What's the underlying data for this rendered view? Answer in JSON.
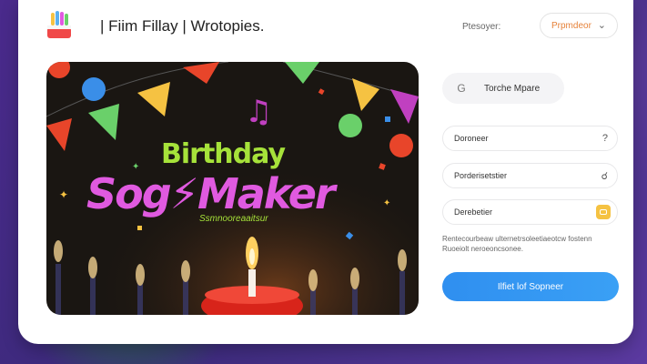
{
  "header": {
    "title": "| Fiim Fillay | Wrotopies.",
    "filter_label": "Ptesoyer:",
    "dropdown_value": "Prpmdeor"
  },
  "hero": {
    "line1": "Birthday",
    "line2": "Sog⚡Maker",
    "subtitle": "Ssmnooreaaitsur"
  },
  "sidebar": {
    "pill_icon": "G",
    "pill_label": "Torche Mpare",
    "fields": [
      {
        "label": "Doroneer",
        "icon": "?"
      },
      {
        "label": "Porderisetstier",
        "icon": "☌"
      },
      {
        "label": "Derebetier",
        "icon": "wallet-icon"
      }
    ],
    "hint": "Rentecourbeaw ulternetrsoleetiaeotcw fostenn Ruoeiolt neroeoncsonee.",
    "cta_label": "Ilfiet lof Sopneer"
  },
  "colors": {
    "accent_orange": "#e6823a",
    "button_blue": "#2f8ff0",
    "title_green": "#a6e23a",
    "title_pink": "#e05ae0",
    "icon_yellow": "#f5c242"
  }
}
